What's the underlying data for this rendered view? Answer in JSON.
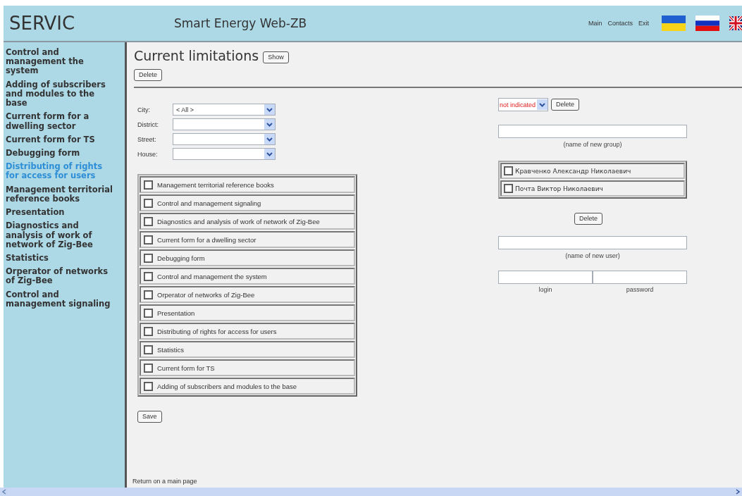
{
  "header": {
    "logo": "SERVIC",
    "title": "Smart Energy Web-ZB",
    "nav": [
      "Main",
      "Contacts",
      "Exit"
    ]
  },
  "sidebar": {
    "items": [
      {
        "label": "Control and management the system",
        "selected": false
      },
      {
        "label": "Adding of subscribers and modules to the base",
        "selected": false
      },
      {
        "label": "Current form for a dwelling sector",
        "selected": false
      },
      {
        "label": "Current form for TS",
        "selected": false
      },
      {
        "label": "Debugging form",
        "selected": false
      },
      {
        "label": "Distributing of rights for access for users",
        "selected": true
      },
      {
        "label": "Management territorial reference books",
        "selected": false
      },
      {
        "label": "Presentation",
        "selected": false
      },
      {
        "label": "Diagnostics and analysis of work of network of Zig-Bee",
        "selected": false
      },
      {
        "label": "Statistics",
        "selected": false
      },
      {
        "label": "Orperator of networks of Zig-Bee",
        "selected": false
      },
      {
        "label": "Control and management signaling",
        "selected": false
      }
    ]
  },
  "main": {
    "heading": "Current limitations",
    "show_button": "Show",
    "delete_button": "Delete",
    "filters": [
      {
        "label": "City:",
        "value": "< All >"
      },
      {
        "label": "District:"
      },
      {
        "label": "Street:"
      },
      {
        "label": "House:"
      }
    ],
    "permissions": [
      {
        "label": "Management territorial reference books",
        "checked": false
      },
      {
        "label": "Control and management signaling",
        "checked": false
      },
      {
        "label": "Diagnostics and analysis of work of network of Zig-Bee",
        "checked": false
      },
      {
        "label": "Current form for a dwelling sector",
        "checked": false
      },
      {
        "label": "Debugging form",
        "checked": false
      },
      {
        "label": "Control and management the system",
        "checked": false
      },
      {
        "label": "Orperator of networks of Zig-Bee",
        "checked": false
      },
      {
        "label": "Presentation",
        "checked": false
      },
      {
        "label": "Distributing of rights for access for users",
        "checked": false
      },
      {
        "label": "Statistics",
        "checked": false
      },
      {
        "label": "Current form for TS",
        "checked": false
      },
      {
        "label": "Adding of subscribers and modules to the base",
        "checked": false
      }
    ],
    "save_button": "Save",
    "footer_link": "Return on a main page"
  },
  "groups": {
    "select_value": "not indicated",
    "delete_button": "Delete",
    "new_group_caption": "(name of new group)",
    "users": [
      {
        "name": "Кравченко Александр Николаевич",
        "checked": false
      },
      {
        "name": "Почта Виктор Николаевич",
        "checked": false
      }
    ],
    "users_delete_button": "Delete",
    "new_user_caption": "(name of new user)",
    "login_caption": "login",
    "password_caption": "password"
  }
}
